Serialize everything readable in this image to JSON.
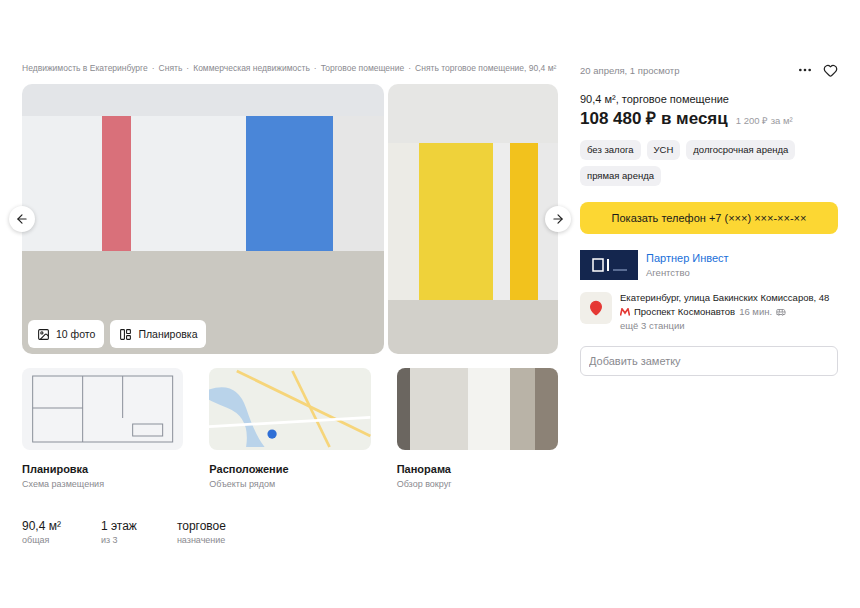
{
  "breadcrumbs": {
    "separator": "·",
    "items": [
      "Недвижимость в Екатеринбурге",
      "Снять",
      "Коммерческая недвижимость",
      "Торговое помещение",
      "Снять торговое помещение, 90,4 м²"
    ]
  },
  "gallery": {
    "photos_button": "10 фото",
    "plan_button": "Планировка"
  },
  "previews": [
    {
      "kind": "plan",
      "title": "Планировка",
      "subtitle": "Схема размещения"
    },
    {
      "kind": "map",
      "title": "Расположение",
      "subtitle": "Объекты рядом"
    },
    {
      "kind": "panorama",
      "title": "Панорама",
      "subtitle": "Обзор вокруг"
    }
  ],
  "facts": [
    {
      "value": "90,4 м²",
      "label": "общая"
    },
    {
      "value": "1 этаж",
      "label": "из 3"
    },
    {
      "value": "торговое",
      "label": "назначение"
    }
  ],
  "meta": "20 апреля, 1 просмотр",
  "subtitle": "90,4 м², торговое помещение",
  "price": "108 480 ₽ в месяц",
  "price_per_m2": "1 200 ₽ за м²",
  "tags": [
    "без залога",
    "УСН",
    "долгосрочная аренда",
    "прямая аренда"
  ],
  "phone_button": "Показать телефон +7 (×××) ×××-××-××",
  "agency": {
    "name": "Партнер Инвест",
    "type": "Агентство"
  },
  "address": {
    "text": "Екатеринбург, улица Бакинских Комиссаров, 48",
    "metro": {
      "name": "Проспект Космонавтов",
      "time": "16 мин."
    },
    "more": "ещё 3 станции"
  },
  "note": {
    "placeholder": "Добавить заметку"
  }
}
